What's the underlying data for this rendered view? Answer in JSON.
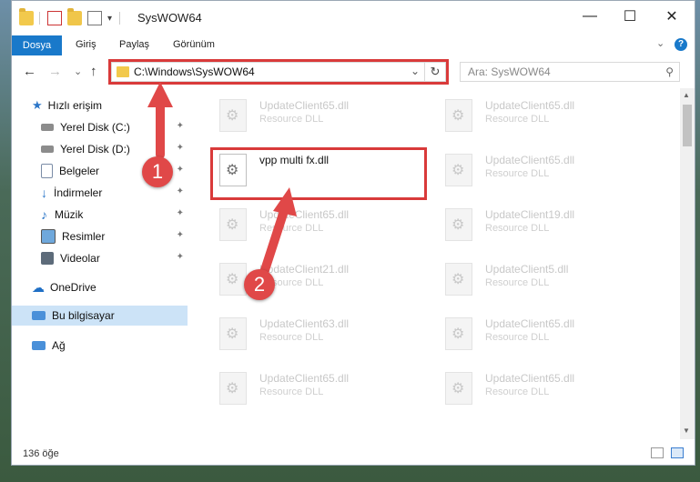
{
  "window": {
    "title": "SysWOW64",
    "buttons": {
      "minimize": "—",
      "maximize": "☐",
      "close": "✕"
    },
    "quick_access_dropdown": "▾"
  },
  "ribbon": {
    "file_tab": "Dosya",
    "tabs": [
      "Giriş",
      "Paylaş",
      "Görünüm"
    ],
    "expand_icon": "⌄",
    "help_icon": "?"
  },
  "nav": {
    "back": "←",
    "forward": "→",
    "recent": "⌄",
    "up": "↑",
    "address": "C:\\Windows\\SysWOW64",
    "address_dropdown": "⌄",
    "refresh": "↻",
    "search_placeholder": "Ara: SysWOW64",
    "search_icon": "⚲"
  },
  "sidebar": {
    "quick_access": "Hızlı erişim",
    "items": [
      {
        "label": "Yerel Disk (C:)",
        "icon": "drive-icon",
        "pinned": true
      },
      {
        "label": "Yerel Disk (D:)",
        "icon": "drive-icon",
        "pinned": true
      },
      {
        "label": "Belgeler",
        "icon": "documents-icon",
        "pinned": true
      },
      {
        "label": "İndirmeler",
        "icon": "downloads-icon",
        "pinned": true
      },
      {
        "label": "Müzik",
        "icon": "music-icon",
        "pinned": true
      },
      {
        "label": "Resimler",
        "icon": "pictures-icon",
        "pinned": true
      },
      {
        "label": "Videolar",
        "icon": "videos-icon",
        "pinned": true
      }
    ],
    "onedrive": "OneDrive",
    "this_pc": "Bu bilgisayar",
    "network": "Ağ",
    "pin_glyph": "📌"
  },
  "files": {
    "left": [
      {
        "name": "UpdateClient65.dll",
        "type": "Resource DLL"
      },
      {
        "name": "vpp multi fx.dll",
        "type": ""
      },
      {
        "name": "UpdateClient65.dll",
        "type": "Resource DLL"
      },
      {
        "name": "UpdateClient21.dll",
        "type": "Resource DLL"
      },
      {
        "name": "UpdateClient63.dll",
        "type": "Resource DLL"
      },
      {
        "name": "UpdateClient65.dll",
        "type": "Resource DLL"
      }
    ],
    "right": [
      {
        "name": "UpdateClient65.dll",
        "type": "Resource DLL"
      },
      {
        "name": "UpdateClient65.dll",
        "type": "Resource DLL"
      },
      {
        "name": "UpdateClient19.dll",
        "type": "Resource DLL"
      },
      {
        "name": "UpdateClient5.dll",
        "type": "Resource DLL"
      },
      {
        "name": "UpdateClient65.dll",
        "type": "Resource DLL"
      },
      {
        "name": "UpdateClient65.dll",
        "type": "Resource DLL"
      }
    ]
  },
  "status": {
    "count": "136 öğe"
  },
  "annotations": {
    "step1": "1",
    "step2": "2",
    "color": "#e04848"
  }
}
